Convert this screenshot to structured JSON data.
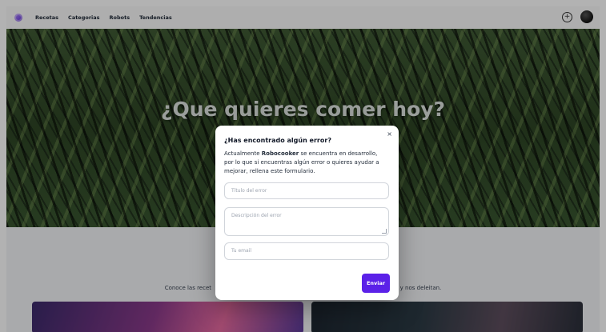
{
  "navbar": {
    "links": [
      "Recetas",
      "Categorias",
      "Robots",
      "Tendencias"
    ],
    "add_button_icon": "plus-circle-icon",
    "avatar": "user-avatar"
  },
  "hero": {
    "title": "¿Que quieres comer hoy?"
  },
  "section": {
    "subtitle_left": "Conoce las recet",
    "subtitle_right": "n y nos deleitan."
  },
  "modal": {
    "close_label": "×",
    "title": "¿Has encontrado algún error?",
    "desc_prefix": "Actualmente ",
    "desc_brand": "Robocooker",
    "desc_suffix": " se encuentra en desarrollo, por lo que si encuentras algún error o quieres ayudar a mejorar, rellena este formulario.",
    "title_placeholder": "Título del error",
    "description_placeholder": "Descripción del error",
    "email_placeholder": "Tu email",
    "submit_label": "Enviar"
  },
  "colors": {
    "accent": "#5b21e8",
    "overlay": "rgba(0,0,0,0.30)"
  }
}
